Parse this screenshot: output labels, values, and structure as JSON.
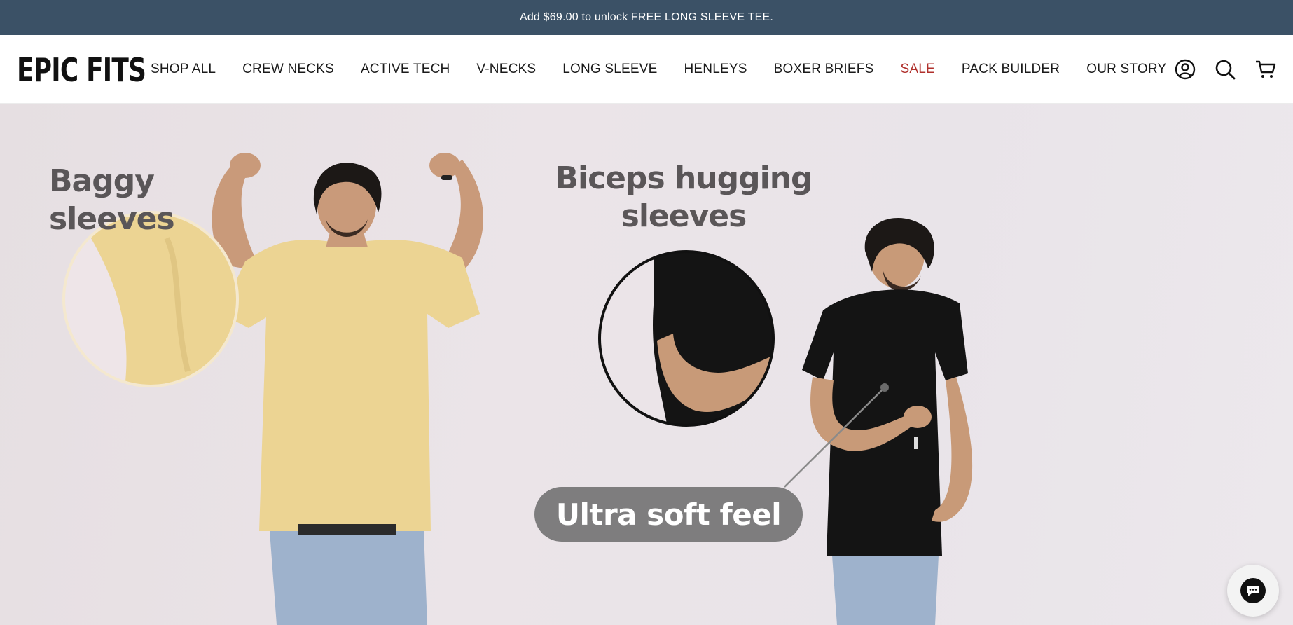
{
  "announcement": {
    "text": "Add $69.00 to unlock FREE LONG SLEEVE TEE."
  },
  "header": {
    "logo": "EPIC FITS",
    "nav": [
      {
        "label": "SHOP ALL"
      },
      {
        "label": "CREW NECKS"
      },
      {
        "label": "ACTIVE TECH"
      },
      {
        "label": "V-NECKS"
      },
      {
        "label": "LONG SLEEVE"
      },
      {
        "label": "HENLEYS"
      },
      {
        "label": "BOXER BRIEFS"
      },
      {
        "label": "SALE"
      },
      {
        "label": "PACK BUILDER"
      },
      {
        "label": "OUR STORY"
      }
    ],
    "icons": [
      "account-icon",
      "search-icon",
      "cart-icon"
    ]
  },
  "hero": {
    "left_caption": "Baggy sleeves",
    "right_caption_line1": "Biceps hugging",
    "right_caption_line2": "sleeves",
    "bubble": "Ultra soft feel"
  },
  "colors": {
    "announcement_bg": "#3b5166",
    "sale": "#b0302c",
    "yellow_tee": "#ecd493",
    "black_tee": "#141414"
  },
  "chat": {
    "icon": "chat-bubble-icon"
  }
}
